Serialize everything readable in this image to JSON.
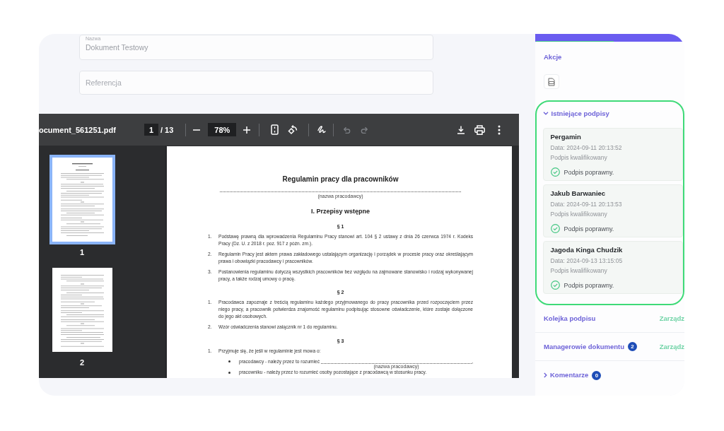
{
  "form": {
    "fields": [
      {
        "label": "Nazwa",
        "value": "Dokument Testowy"
      },
      {
        "placeholder": "Referencja"
      }
    ]
  },
  "pdf_viewer": {
    "toolbar": {
      "file_name": "ocument_561251.pdf",
      "page": "1",
      "page_count": "/ 13",
      "zoom": "78%",
      "undo": {
        "disabled": true
      },
      "redo": {
        "disabled": true
      }
    },
    "thumbnails": [
      {
        "label": "1",
        "selected": true
      },
      {
        "label": "2",
        "selected": false
      }
    ],
    "document": {
      "title": "Regulamin pracy dla pracowników",
      "employer_caption": "(nazwa pracodawcy)",
      "chapter": "I. Przepisy wstępne",
      "sections": [
        {
          "heading": "§ 1",
          "items": [
            {
              "number": "1.",
              "text": "Podstawę prawną dla wprowadzenia Regulaminu Pracy stanowi art. 104 § 2 ustawy z dnia 26 czerwca 1974 r. Kodeks Pracy (Dz. U. z 2018 r. poz. 917 z późn. zm.)."
            },
            {
              "number": "2.",
              "text": "Regulamin Pracy jest aktem prawa zakładowego ustalającym organizację i porządek w procesie pracy oraz określającym prawa i obowiązki pracodawcy i pracowników."
            },
            {
              "number": "3.",
              "text": "Postanowienia regulaminu dotyczą wszystkich pracowników bez względu na zajmowane stanowisko i rodzaj wykonywanej pracy, a także rodzaj umowy o pracę."
            }
          ]
        },
        {
          "heading": "§ 2",
          "items": [
            {
              "number": "1.",
              "text": "Pracodawca zapoznaje z treścią regulaminu każdego przyjmowanego do pracy pracownika przed rozpoczęciem przez niego pracy, a pracownik potwierdza znajomość regulaminu podpisując stosowne oświadczenie, które zostaje dołączone do jego akt osobowych."
            },
            {
              "number": "2.",
              "text": "Wzór oświadczenia stanowi załącznik nr 1 do regulaminu."
            }
          ]
        },
        {
          "heading": "§ 3",
          "items": [
            {
              "number": "1.",
              "text": "Przyjmuje się, że jeśli w regulaminie jest mowa o:",
              "children": [
                {
                  "text": "pracodawcy - należy przez to rozumieć",
                  "blank_caption": "(nazwa pracodawcy)",
                  "suffix": ","
                },
                {
                  "text": "pracowniku - należy przez to rozumieć osoby pozostające z pracodawcą w stosunku pracy."
                }
              ]
            }
          ]
        }
      ]
    }
  },
  "sidebar": {
    "actions": {
      "title": "Akcje"
    },
    "signatures": {
      "title": "Istniejące podpisy",
      "expanded": true,
      "items": [
        {
          "name": "Pergamin",
          "date": "Data: 2024-09-11 20:13:52",
          "type": "Podpis kwalifikowany",
          "status": "Podpis poprawny.",
          "valid": true
        },
        {
          "name": "Jakub Barwaniec",
          "date": "Data: 2024-09-11 20:13:53",
          "type": "Podpis kwalifikowany",
          "status": "Podpis poprawny.",
          "valid": true
        },
        {
          "name": "Jagoda Kinga Chudzik",
          "date": "Data: 2024-09-13 13:15:05",
          "type": "Podpis kwalifikowany",
          "status": "Podpis poprawny.",
          "valid": true
        }
      ]
    },
    "sections": [
      {
        "title": "Kolejka podpisu",
        "link": "Zarządz"
      },
      {
        "title": "Managerowie dokumentu",
        "badge": "2",
        "link": "Zarządz"
      },
      {
        "title": "Komentarze",
        "badge": "0",
        "expanded": false
      }
    ]
  }
}
